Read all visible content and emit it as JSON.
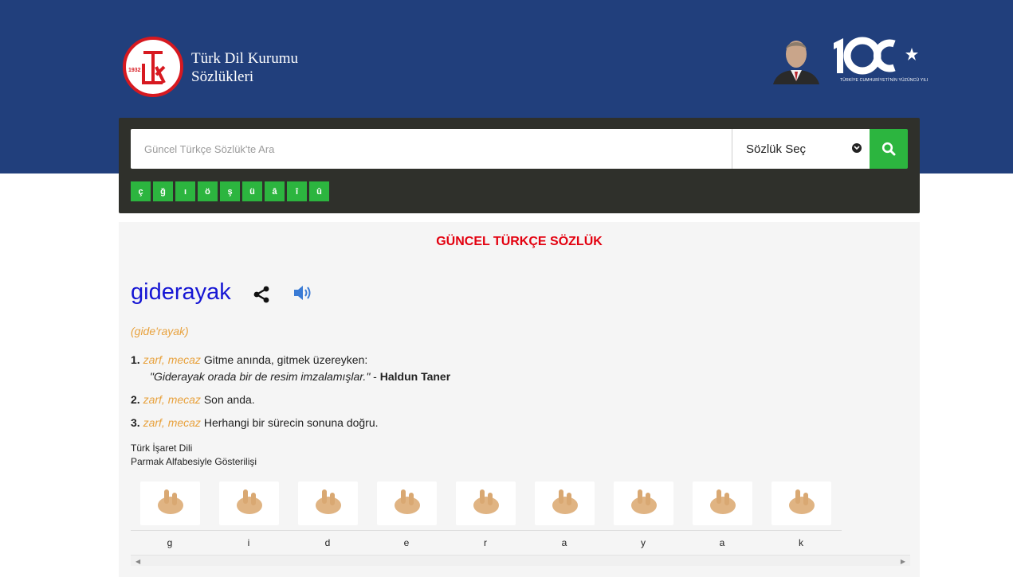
{
  "header": {
    "brand_line1": "Türk Dil Kurumu",
    "brand_line2": "Sözlükleri",
    "logo_year": "1932",
    "centennial_caption": "TÜRKİYE CUMHURİYETİ'NİN YÜZÜNCÜ YILI",
    "bg_color": "#213f7c"
  },
  "search": {
    "placeholder": "Güncel Türkçe Sözlük'te Ara",
    "dictionary_select": "Sözlük Seç",
    "button_icon": "search-icon",
    "special_letters": [
      "ç",
      "ğ",
      "ı",
      "ö",
      "ş",
      "ü",
      "â",
      "î",
      "û"
    ],
    "accent_color": "#2cb53f"
  },
  "result": {
    "dictionary_title": "GÜNCEL TÜRKÇE SÖZLÜK",
    "word": "giderayak",
    "pronunciation": "(gide'rayak)",
    "meanings": [
      {
        "num": "1.",
        "tags": "zarf, mecaz",
        "text": "Gitme anında, gitmek üzereyken:",
        "example": "\"Giderayak orada bir de resim imzalamışlar.\"",
        "example_sep": " - ",
        "author": "Haldun Taner"
      },
      {
        "num": "2.",
        "tags": "zarf, mecaz",
        "text": "Son anda."
      },
      {
        "num": "3.",
        "tags": "zarf, mecaz",
        "text": "Herhangi bir sürecin sonuna doğru."
      }
    ],
    "sign_language_line1": "Türk İşaret Dili",
    "sign_language_line2": "Parmak Alfabesiyle Gösterilişi",
    "finger_letters": [
      "g",
      "i",
      "d",
      "e",
      "r",
      "a",
      "y",
      "a",
      "k"
    ],
    "title_color": "#e3000f",
    "word_color": "#1616d4",
    "tag_color": "#e8a13c"
  }
}
